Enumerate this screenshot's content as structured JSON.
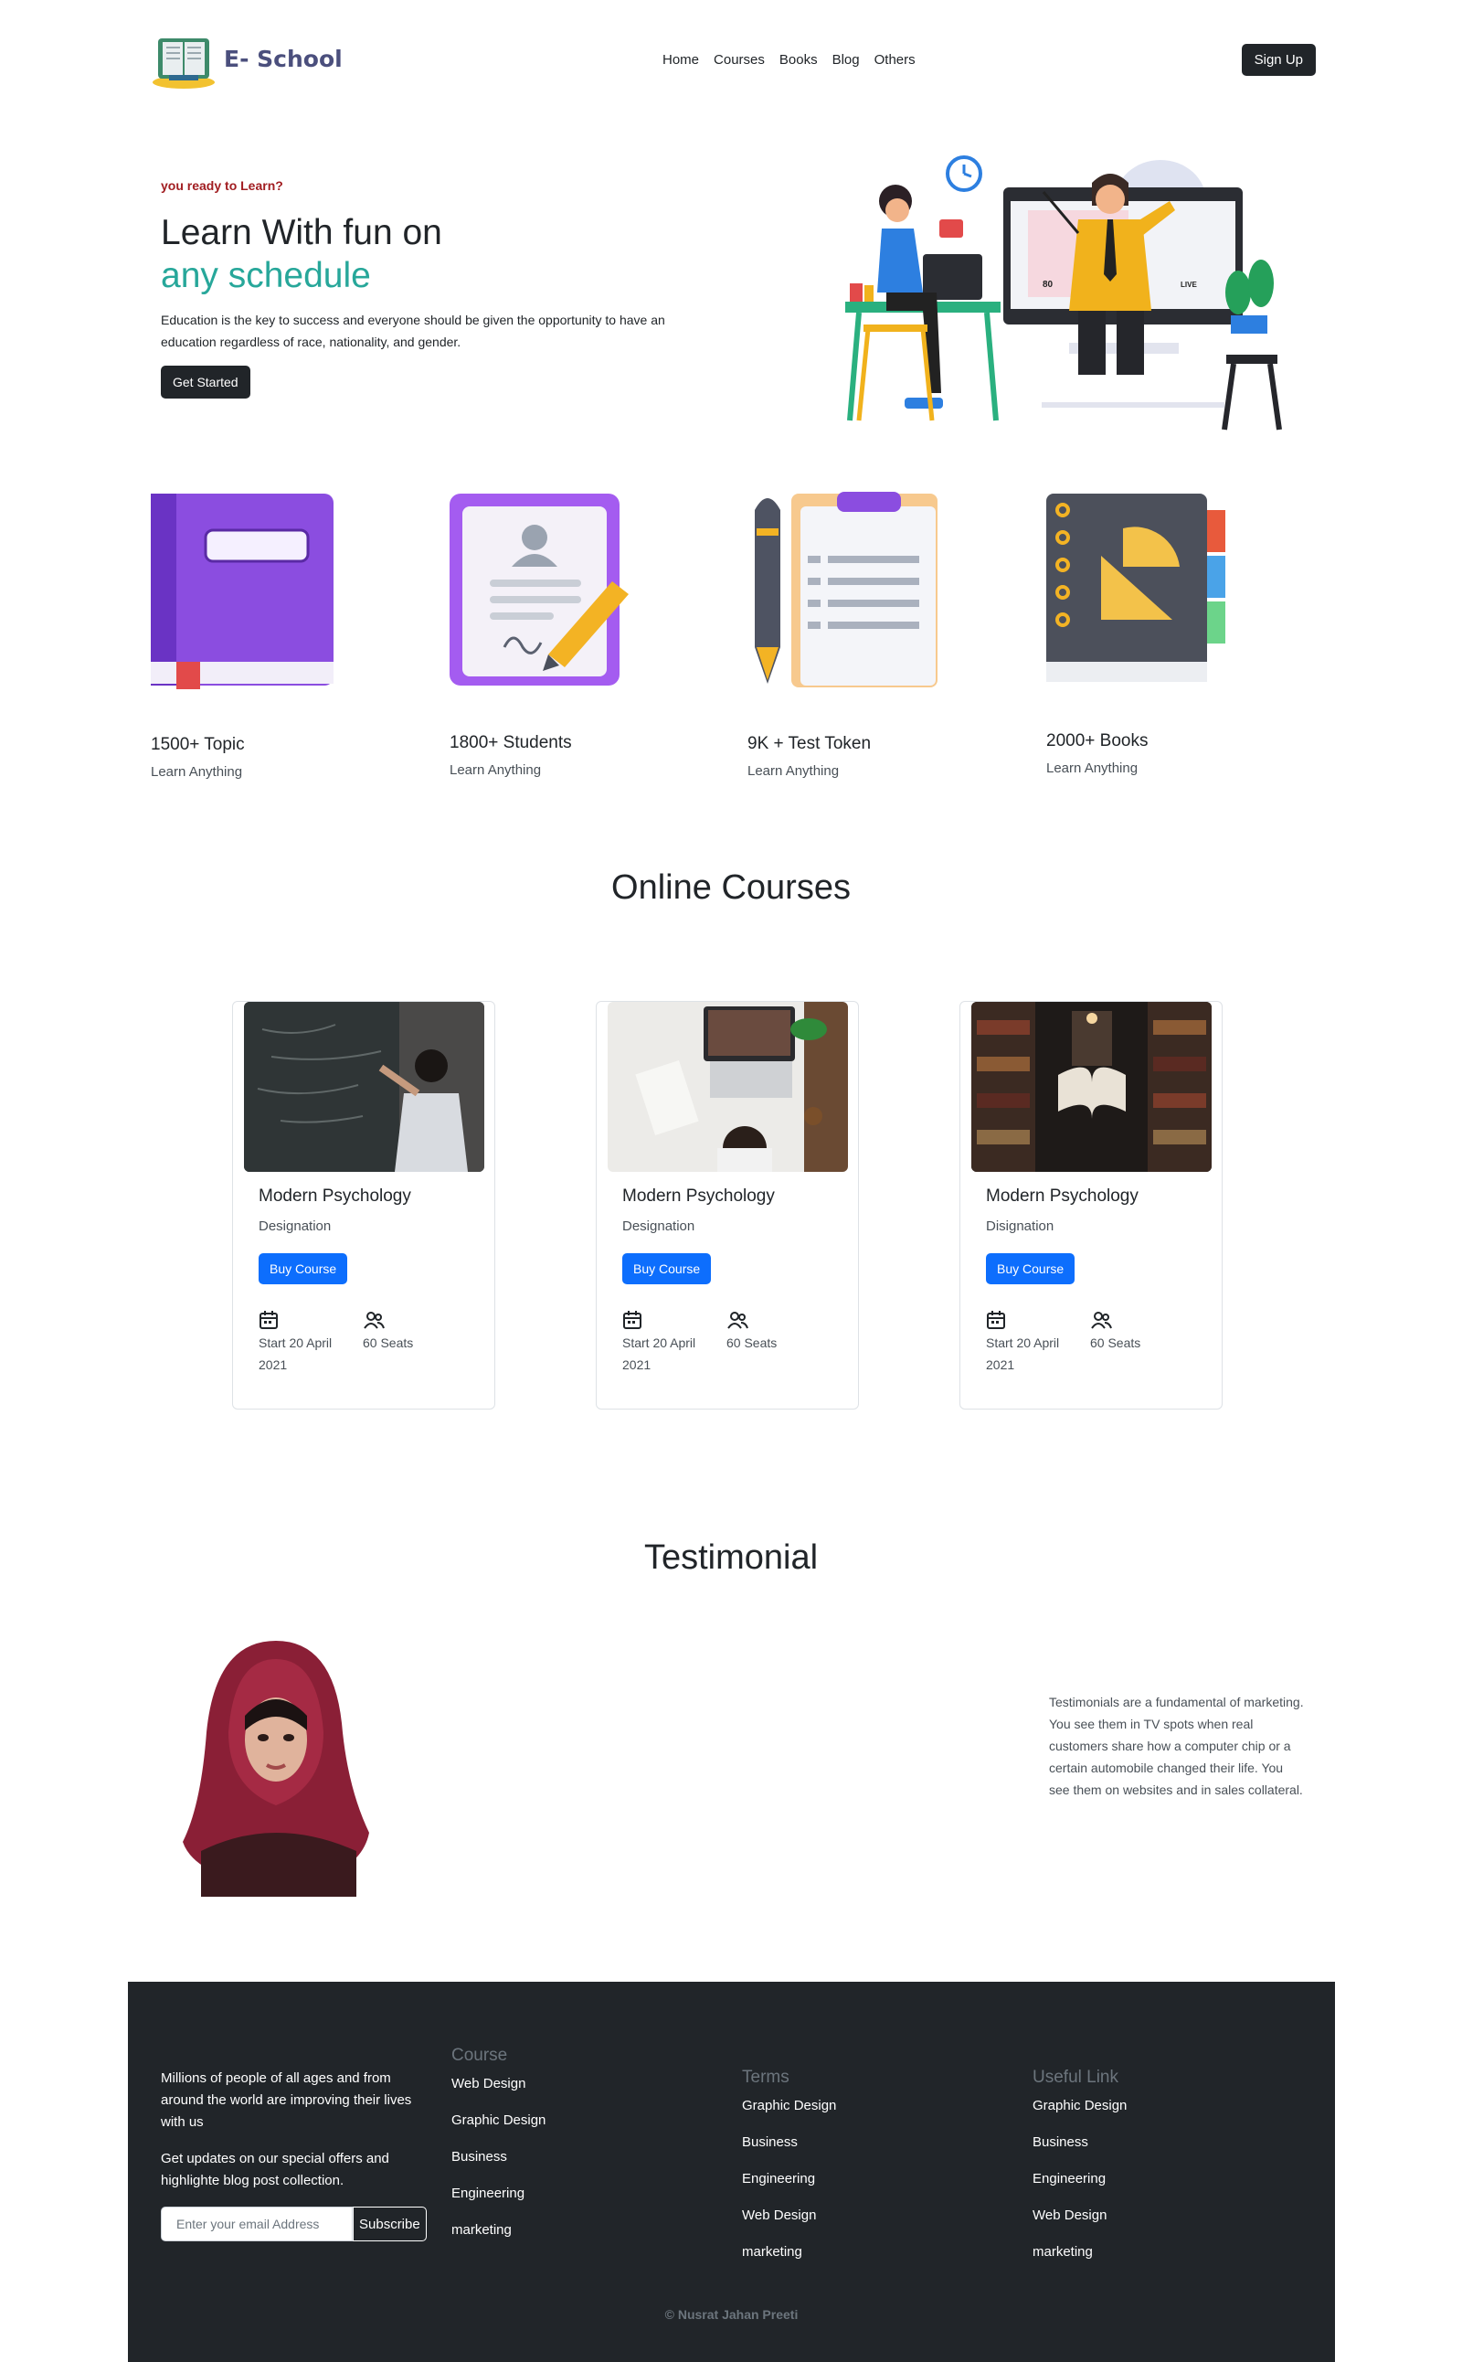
{
  "nav": {
    "brand": "E- School",
    "links": [
      "Home",
      "Courses",
      "Books",
      "Blog",
      "Others"
    ],
    "signup": "Sign Up"
  },
  "hero": {
    "kicker": "you ready to Learn?",
    "title_line1": "Learn With fun on",
    "title_line2": "any schedule",
    "description": "Education is the key to success and everyone should be given the opportunity to have an education regardless of race, nationality, and gender.",
    "cta": "Get Started",
    "illustration_labels": {
      "score": "80",
      "live": "LIVE"
    }
  },
  "stats": [
    {
      "title": "1500+ Topic",
      "sub": "Learn Anything",
      "icon": "purple-book-icon"
    },
    {
      "title": "1800+ Students",
      "sub": "Learn Anything",
      "icon": "student-profile-icon"
    },
    {
      "title": "9K + Test Token",
      "sub": "Learn Anything",
      "icon": "clipboard-test-icon"
    },
    {
      "title": "2000+ Books",
      "sub": "Learn Anything",
      "icon": "notebook-ruler-icon"
    }
  ],
  "courses_section": {
    "title": "Online Courses"
  },
  "courses": [
    {
      "title": "Modern Psychology",
      "sub": "Designation",
      "button": "Buy Course",
      "start": "Start 20 April 2021",
      "seats": "60 Seats"
    },
    {
      "title": "Modern Psychology",
      "sub": "Designation",
      "button": "Buy Course",
      "start": "Start 20 April 2021",
      "seats": "60 Seats"
    },
    {
      "title": "Modern Psychology",
      "sub": "Disignation",
      "button": "Buy Course",
      "start": "Start 20 April 2021",
      "seats": "60 Seats"
    }
  ],
  "testimonial": {
    "title": "Testimonial",
    "text": "Testimonials are a fundamental of marketing. You see them in TV spots when real customers share how a computer chip or a certain automobile changed their life. You see them on websites and in sales collateral."
  },
  "footer": {
    "about1": "Millions of people of all ages and from around the world are improving their lives with us",
    "about2": "Get updates on our special offers and highlighte blog post collection.",
    "email_placeholder": "Enter your email Address",
    "subscribe": "Subscribe",
    "course": {
      "title": "Course",
      "items": [
        "Web Design",
        "Graphic Design",
        "Business",
        "Engineering",
        "marketing"
      ]
    },
    "terms": {
      "title": "Terms",
      "items": [
        "Graphic Design",
        "Business",
        "Engineering",
        "Web Design",
        "marketing"
      ]
    },
    "useful": {
      "title": "Useful Link",
      "items": [
        "Graphic Design",
        "Business",
        "Engineering",
        "Web Design",
        "marketing"
      ]
    },
    "copyright": "© Nusrat Jahan Preeti"
  },
  "colors": {
    "dark": "#212529",
    "accent_teal": "#27a79a",
    "accent_red": "#a11d21",
    "primary_blue": "#0d6efd",
    "brand": "#4b4f7d"
  }
}
